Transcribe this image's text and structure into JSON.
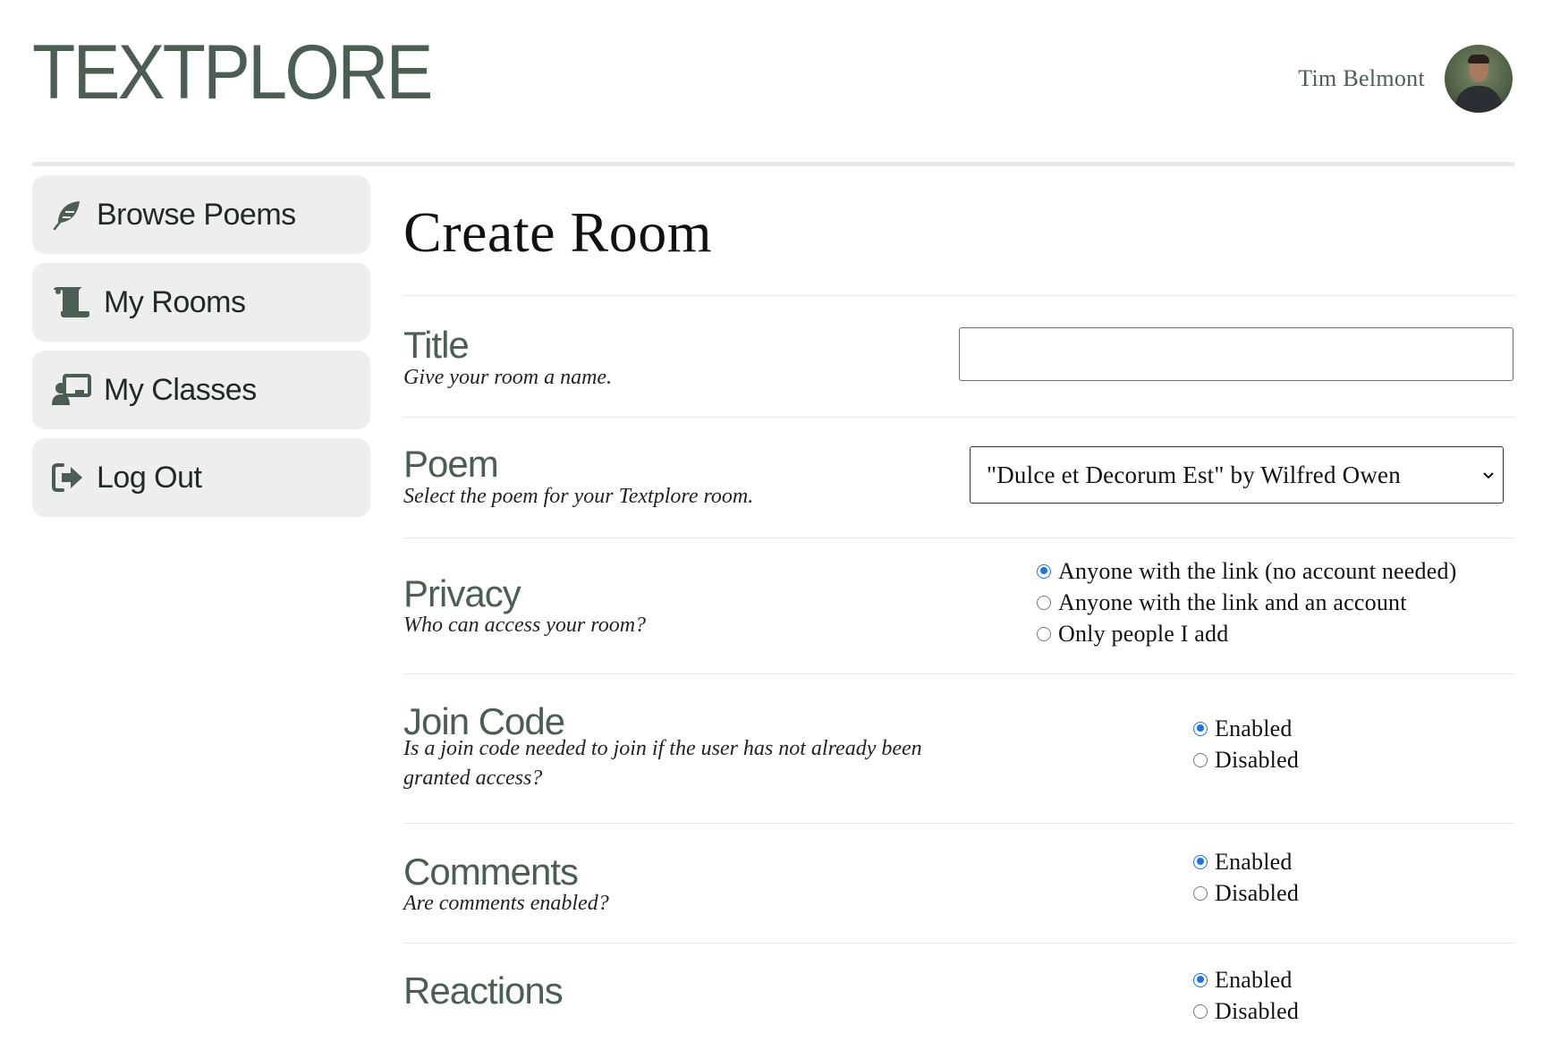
{
  "app": {
    "logo": "TEXTPLORE",
    "user_name": "Tim Belmont"
  },
  "sidebar": {
    "items": [
      {
        "label": "Browse Poems",
        "icon": "feather-icon"
      },
      {
        "label": "My Rooms",
        "icon": "scroll-icon"
      },
      {
        "label": "My Classes",
        "icon": "teacher-board-icon"
      },
      {
        "label": "Log Out",
        "icon": "logout-icon"
      }
    ]
  },
  "page": {
    "title": "Create Room"
  },
  "form": {
    "title": {
      "label": "Title",
      "description": "Give your room a name.",
      "value": ""
    },
    "poem": {
      "label": "Poem",
      "description": "Select the poem for your Textplore room.",
      "selected": "\"Dulce et Decorum Est\" by Wilfred Owen"
    },
    "privacy": {
      "label": "Privacy",
      "description": "Who can access your room?",
      "options": [
        "Anyone with the link (no account needed)",
        "Anyone with the link and an account",
        "Only people I add"
      ],
      "selected_index": 0
    },
    "join_code": {
      "label": "Join Code",
      "description": "Is a join code needed to join if the user has not already been granted access?",
      "options": [
        "Enabled",
        "Disabled"
      ],
      "selected_index": 0
    },
    "comments": {
      "label": "Comments",
      "description": "Are comments enabled?",
      "options": [
        "Enabled",
        "Disabled"
      ],
      "selected_index": 0
    },
    "reactions": {
      "label": "Reactions",
      "options": [
        "Enabled",
        "Disabled"
      ],
      "selected_index": 0
    }
  },
  "colors": {
    "brand": "#4b5e52",
    "nav_bg": "#eeeeee",
    "radio_accent": "#1a73e8"
  }
}
